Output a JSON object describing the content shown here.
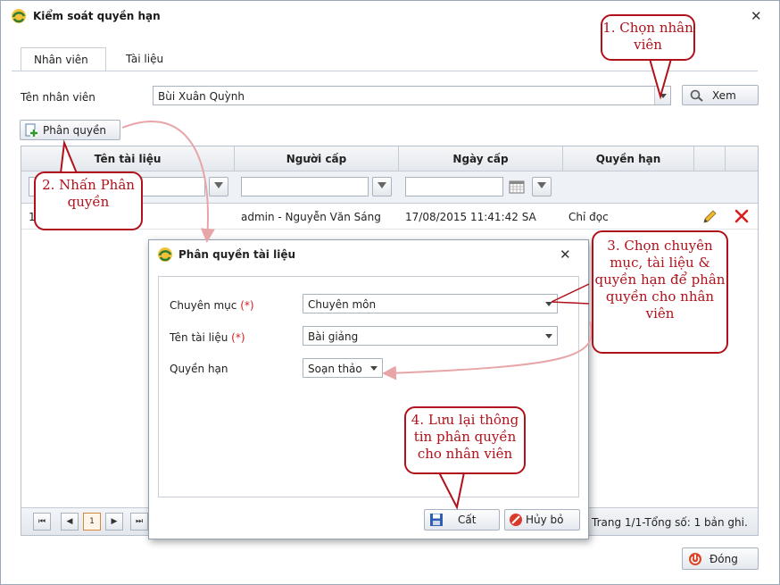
{
  "window": {
    "title": "Kiểm soát quyền hạn",
    "close": "✕"
  },
  "tabs": [
    {
      "label": "Nhân viên",
      "active": true
    },
    {
      "label": "Tài liệu",
      "active": false
    }
  ],
  "employee": {
    "label": "Tên nhân viên",
    "value": "Bùi Xuân Quỳnh",
    "search_button": "Xem"
  },
  "assign_button": "Phân quyền",
  "grid": {
    "columns": [
      "Tên tài liệu",
      "Người cấp",
      "Ngày cấp",
      "Quyền hạn"
    ],
    "rows": [
      {
        "doc": "1",
        "granter": "admin - Nguyễn Văn Sáng",
        "date": "17/08/2015 11:41:42 SA",
        "permission": "Chỉ đọc"
      }
    ],
    "pager": {
      "current_page": "1",
      "summary": "Trang 1/1-Tổng số: 1 bản ghi."
    }
  },
  "dialog": {
    "title": "Phân quyền tài liệu",
    "close": "✕",
    "fields": {
      "category": {
        "label": "Chuyên mục",
        "required": "(*)",
        "value": "Chuyên môn"
      },
      "document": {
        "label": "Tên tài liệu",
        "required": "(*)",
        "value": "Bài giảng"
      },
      "permission": {
        "label": "Quyền hạn",
        "value": "Soạn thảo"
      }
    },
    "save_button": "Cất",
    "cancel_button": "Hủy bỏ"
  },
  "close_button": "Đóng",
  "callouts": {
    "c1": "1. Chọn nhân viên",
    "c2": "2. Nhấn Phân quyền",
    "c3": "3. Chọn chuyên mục, tài liệu & quyền hạn để phân quyền cho nhân viên",
    "c4": "4. Lưu lại thông tin phân quyền cho nhân viên"
  },
  "colors": {
    "callout": "#b0111b",
    "arrow": "#e8a5a8",
    "accent": "#2e7d32"
  }
}
